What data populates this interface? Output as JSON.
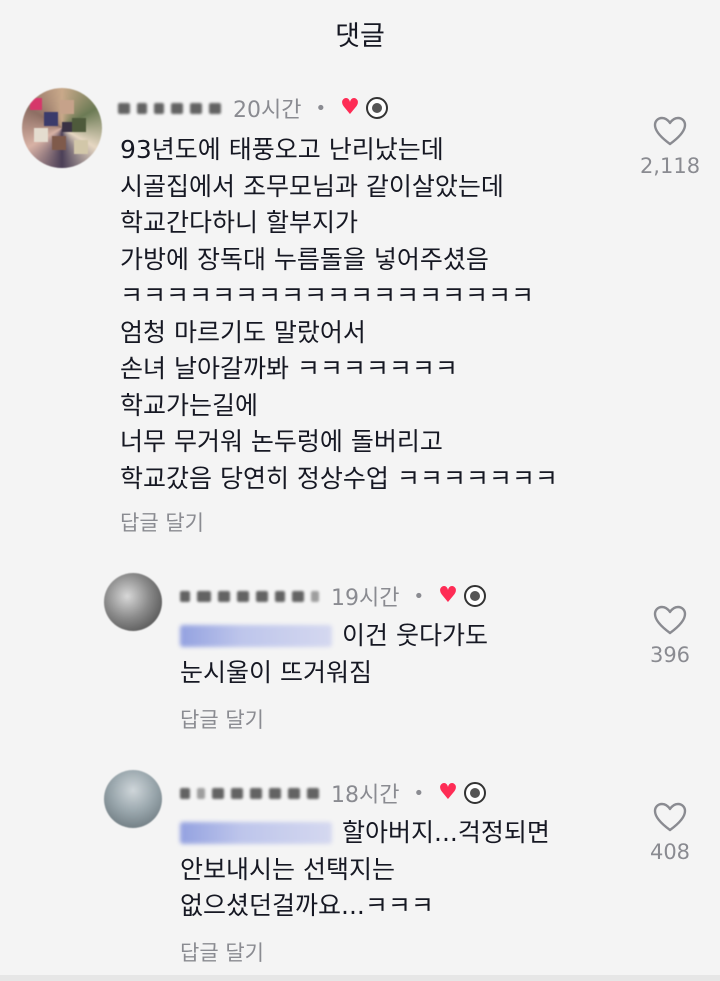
{
  "header": {
    "title": "댓글"
  },
  "comments": [
    {
      "time": "20시간",
      "dot": "•",
      "lines": [
        "93년도에 태풍오고 난리났는데",
        "시골집에서 조무모님과 같이살았는데",
        "학교간다하니 할부지가",
        "가방에 장독대 누름돌을 넣어주셨음",
        "ㅋㅋㅋㅋㅋㅋㅋㅋㅋㅋㅋㅋㅋㅋㅋㅋㅋㅋ",
        "엄청 마르기도 말랐어서",
        "손녀 날아갈까봐 ㅋㅋㅋㅋㅋㅋㅋ",
        "학교가는길에",
        "너무 무거워 논두렁에 돌버리고",
        "학교갔음 당연히 정상수업 ㅋㅋㅋㅋㅋㅋㅋ"
      ],
      "reply_label": "답글 달기",
      "likes": "2,118"
    },
    {
      "time": "19시간",
      "dot": "•",
      "line1_rest": "이건 웃다가도",
      "line2": "눈시울이 뜨거워짐",
      "reply_label": "답글 달기",
      "likes": "396"
    },
    {
      "time": "18시간",
      "dot": "•",
      "line1_rest": "할아버지...걱정되면",
      "line2": "안보내시는 선택지는",
      "line3": "없으셨던걸까요...ㅋㅋㅋ",
      "reply_label": "답글 달기",
      "likes": "408"
    }
  ],
  "icons": {
    "heart_outline": "heart-outline-icon",
    "creator_liked": "heart-icon",
    "creator_avatar": "creator-avatar-icon"
  },
  "colors": {
    "accent_red": "#fe2c55",
    "muted": "#8a8b91",
    "text": "#161823"
  }
}
